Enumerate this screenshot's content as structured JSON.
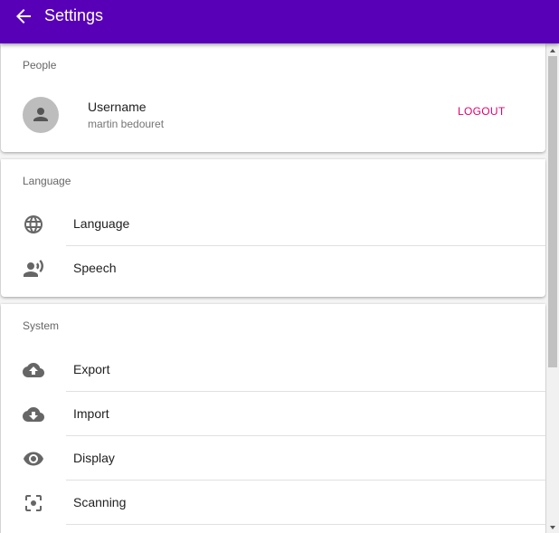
{
  "appbar": {
    "title": "Settings",
    "back_icon": "arrow-back-icon",
    "background": "#5800b8"
  },
  "people": {
    "section_title": "People",
    "username_label": "Username",
    "username_value": "martin bedouret",
    "logout_label": "LOGOUT",
    "avatar_icon": "person-icon",
    "accent": "#e4006b"
  },
  "language": {
    "section_title": "Language",
    "items": [
      {
        "label": "Language",
        "icon": "globe-icon"
      },
      {
        "label": "Speech",
        "icon": "record-voice-icon"
      }
    ]
  },
  "system": {
    "section_title": "System",
    "items": [
      {
        "label": "Export",
        "icon": "cloud-upload-icon"
      },
      {
        "label": "Import",
        "icon": "cloud-download-icon"
      },
      {
        "label": "Display",
        "icon": "eye-icon"
      },
      {
        "label": "Scanning",
        "icon": "scan-icon"
      }
    ]
  }
}
